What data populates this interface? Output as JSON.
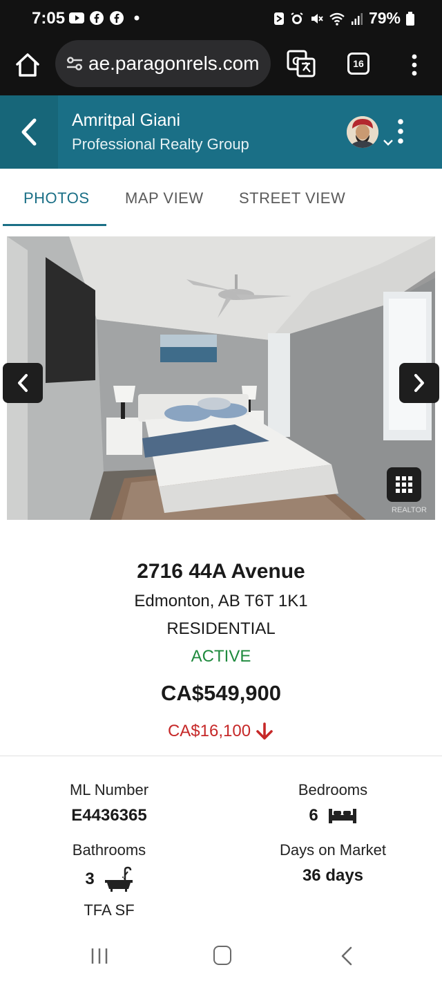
{
  "status_bar": {
    "time": "7:05",
    "battery": "79%"
  },
  "browser": {
    "url": "ae.paragonrels.com",
    "tab_count": "16"
  },
  "header": {
    "agent_name": "Amritpal Giani",
    "company": "Professional Realty Group"
  },
  "tabs": [
    {
      "label": "PHOTOS",
      "active": true
    },
    {
      "label": "MAP VIEW",
      "active": false
    },
    {
      "label": "STREET VIEW",
      "active": false
    }
  ],
  "listing": {
    "address": "2716 44A Avenue",
    "city": "Edmonton, AB T6T 1K1",
    "property_type": "RESIDENTIAL",
    "status": "ACTIVE",
    "price": "CA$549,900",
    "price_change": "CA$16,100"
  },
  "facts": {
    "ml_number_label": "ML Number",
    "ml_number": "E4436365",
    "bedrooms_label": "Bedrooms",
    "bedrooms": "6",
    "bathrooms_label": "Bathrooms",
    "bathrooms": "3",
    "dom_label": "Days on Market",
    "dom": "36 days",
    "tfa_label": "TFA SF"
  },
  "photo": {
    "watermark": "REALTOR"
  },
  "colors": {
    "header_teal": "#1a6f86",
    "status_green": "#1f8a3e",
    "drop_red": "#c62828"
  }
}
